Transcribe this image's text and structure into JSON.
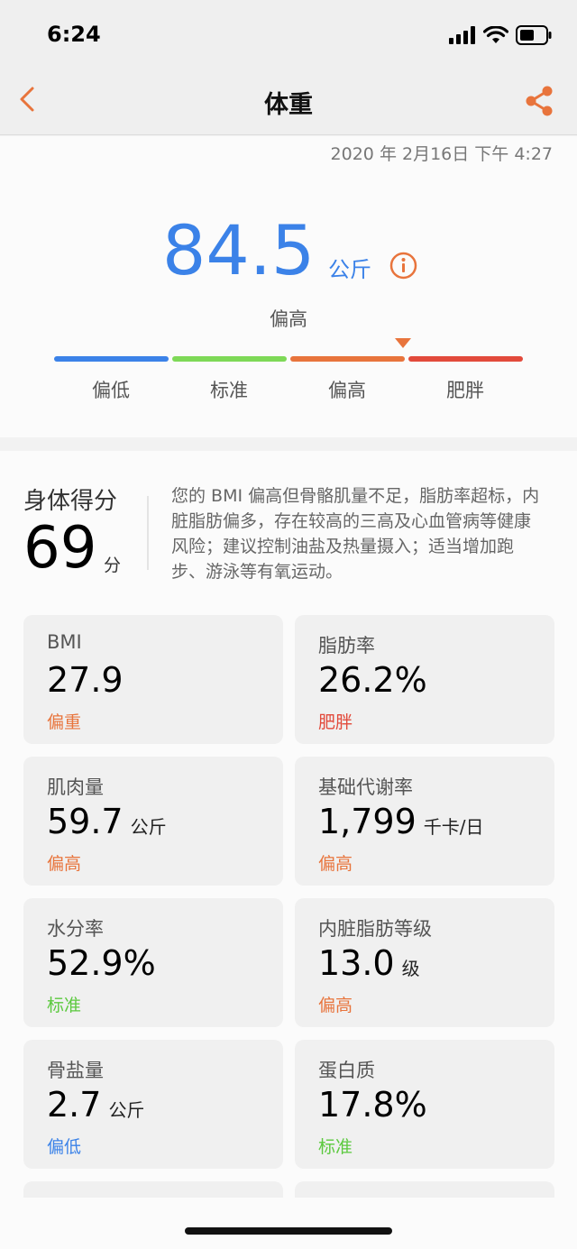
{
  "status_bar": {
    "time": "6:24"
  },
  "nav": {
    "title": "体重"
  },
  "weight": {
    "timestamp": "2020 年 2月16日 下午 4:27",
    "value": "84.5",
    "unit": "公斤",
    "status": "偏高",
    "scale_labels": [
      "偏低",
      "标准",
      "偏高",
      "肥胖"
    ],
    "scale_colors": [
      "#3b82e8",
      "#7ed957",
      "#e8743c",
      "#e24a3b"
    ]
  },
  "score": {
    "title": "身体得分",
    "value": "69",
    "unit": "分",
    "description": "您的 BMI 偏高但骨骼肌量不足，脂肪率超标，内脏脂肪偏多，存在较高的三高及心血管病等健康风险；建议控制油盐及热量摄入；适当增加跑步、游泳等有氧运动。"
  },
  "metrics": [
    {
      "name": "BMI",
      "value": "27.9",
      "unit": "",
      "status": "偏重"
    },
    {
      "name": "脂肪率",
      "value": "26.2%",
      "unit": "",
      "status": "肥胖"
    },
    {
      "name": "肌肉量",
      "value": "59.7",
      "unit": "公斤",
      "status": "偏高"
    },
    {
      "name": "基础代谢率",
      "value": "1,799",
      "unit": "千卡/日",
      "status": "偏高"
    },
    {
      "name": "水分率",
      "value": "52.9%",
      "unit": "",
      "status": "标准"
    },
    {
      "name": "内脏脂肪等级",
      "value": "13.0",
      "unit": "级",
      "status": "偏高"
    },
    {
      "name": "骨盐量",
      "value": "2.7",
      "unit": "公斤",
      "status": "偏低"
    },
    {
      "name": "蛋白质",
      "value": "17.8%",
      "unit": "",
      "status": "标准"
    }
  ],
  "colors": {
    "accent": "#e8743c",
    "blue": "#3b82e8",
    "green": "#5cc93f",
    "red": "#e24a3b"
  }
}
